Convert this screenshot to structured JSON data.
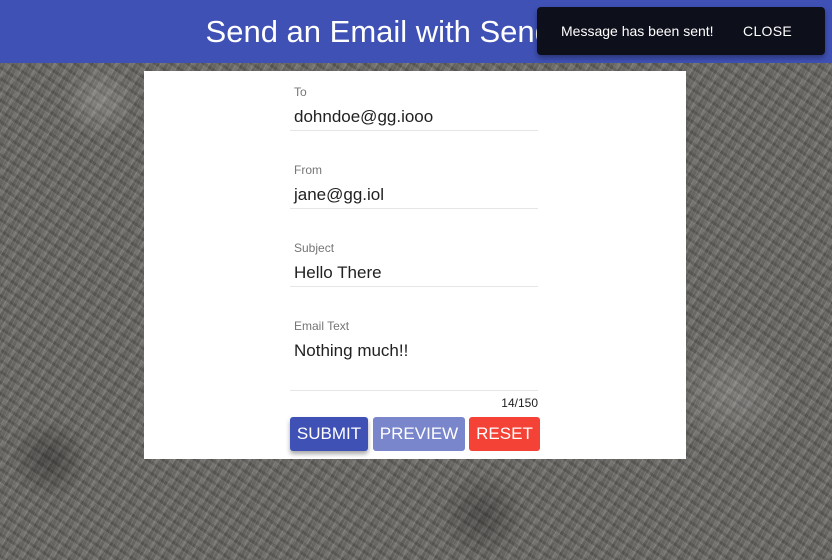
{
  "app_bar": {
    "title": "Send an Email with SendGrid"
  },
  "snackbar": {
    "message": "Message has been sent!",
    "close_label": "CLOSE"
  },
  "form": {
    "to": {
      "label": "To",
      "value": "dohndoe@gg.iooo"
    },
    "from": {
      "label": "From",
      "value": "jane@gg.iol"
    },
    "subject": {
      "label": "Subject",
      "value": "Hello There"
    },
    "email_text": {
      "label": "Email Text",
      "value": "Nothing much!!"
    },
    "char_counter": "14/150",
    "buttons": {
      "submit": "SUBMIT",
      "preview": "PREVIEW",
      "reset": "RESET"
    }
  },
  "colors": {
    "primary": "#3f51b5",
    "primary_light": "#7986cb",
    "danger": "#f44336",
    "snackbar": "#0d0f1b"
  }
}
